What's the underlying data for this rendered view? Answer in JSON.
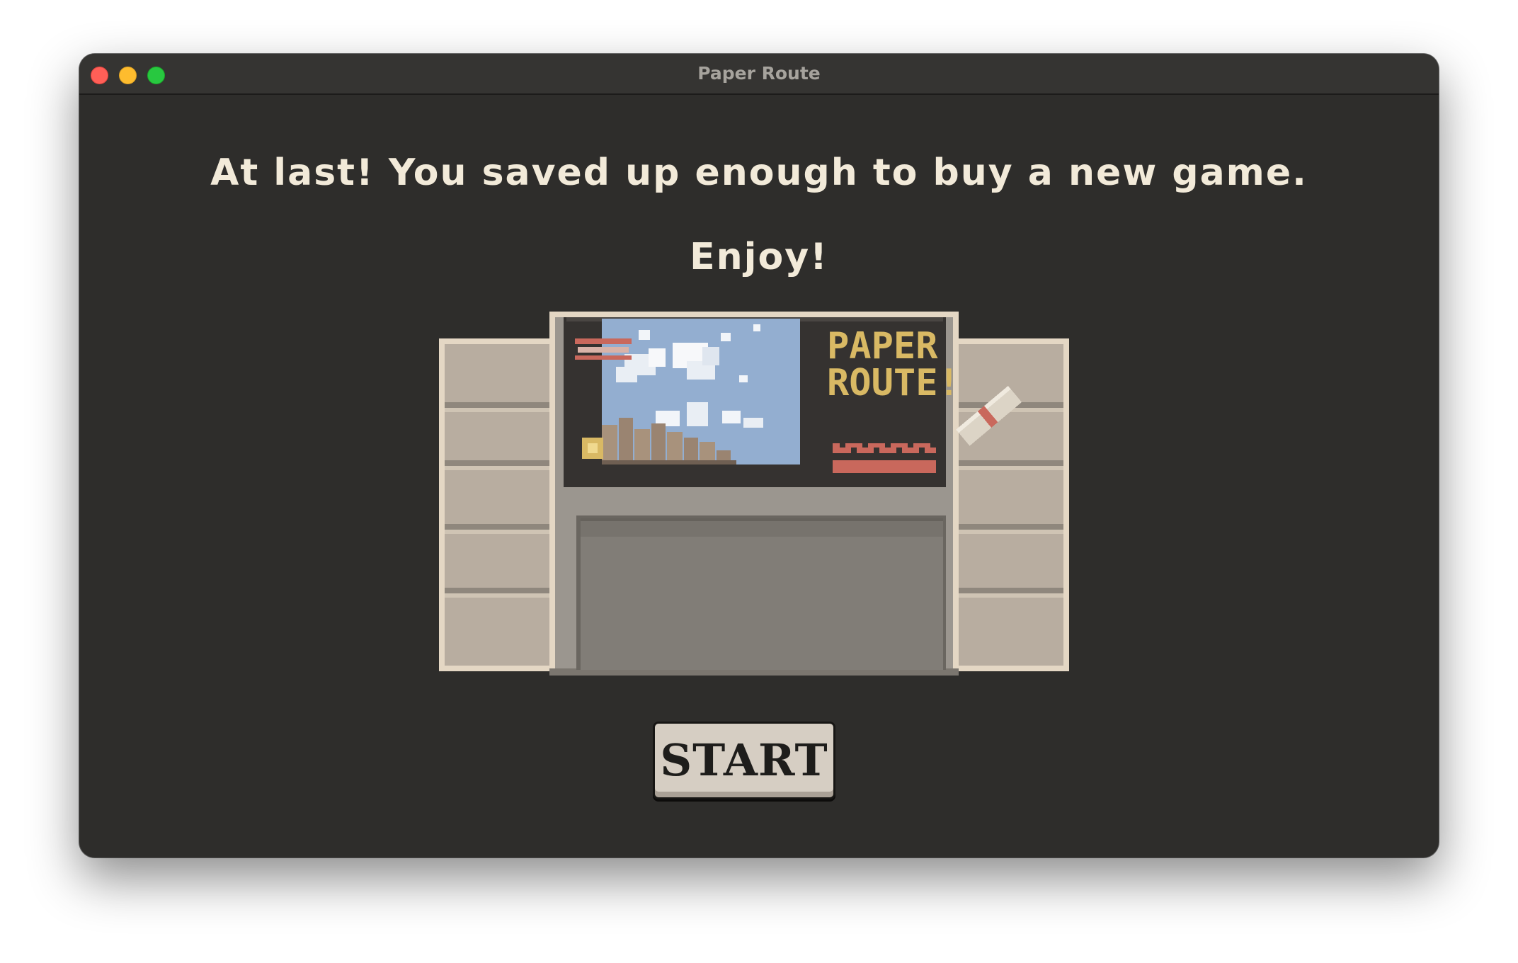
{
  "window": {
    "title": "Paper Route"
  },
  "message": {
    "line1": "At last! You saved up enough to buy a new game.",
    "line2": "Enjoy!"
  },
  "cartridge": {
    "label_title_line1": "PAPER",
    "label_title_line2": "ROUTE!"
  },
  "start_button": {
    "label": "START"
  },
  "colors": {
    "background": "#2e2d2b",
    "text": "#f2ead9",
    "cartridge_body": "#9b968f",
    "cartridge_grip": "#b8ada0",
    "label_dark": "#353230",
    "label_sky": "#93aed0",
    "title_gold": "#d9b964",
    "accent_red": "#c9685c"
  }
}
